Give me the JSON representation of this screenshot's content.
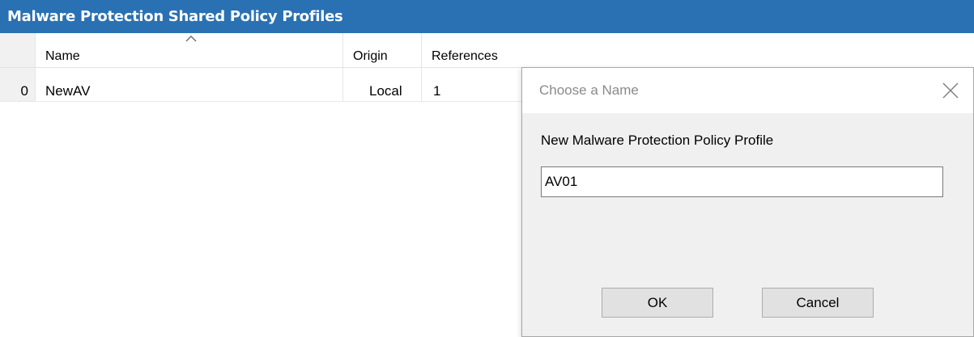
{
  "window": {
    "title": "Malware Protection Shared Policy Profiles"
  },
  "grid": {
    "columns": [
      {
        "label": "Name",
        "sorted": "ascending"
      },
      {
        "label": "Origin"
      },
      {
        "label": "References"
      }
    ],
    "rows": [
      {
        "index": "0",
        "name": "NewAV",
        "origin": "Local",
        "references": "1"
      }
    ]
  },
  "dialog": {
    "title": "Choose a Name",
    "prompt": "New Malware Protection Policy Profile",
    "input_value": "AV01",
    "ok_label": "OK",
    "cancel_label": "Cancel",
    "close_icon": "close-icon"
  },
  "colors": {
    "title_bar": "#2a71b3",
    "dialog_background": "#f0f0f0",
    "button_face": "#e1e1e1"
  }
}
